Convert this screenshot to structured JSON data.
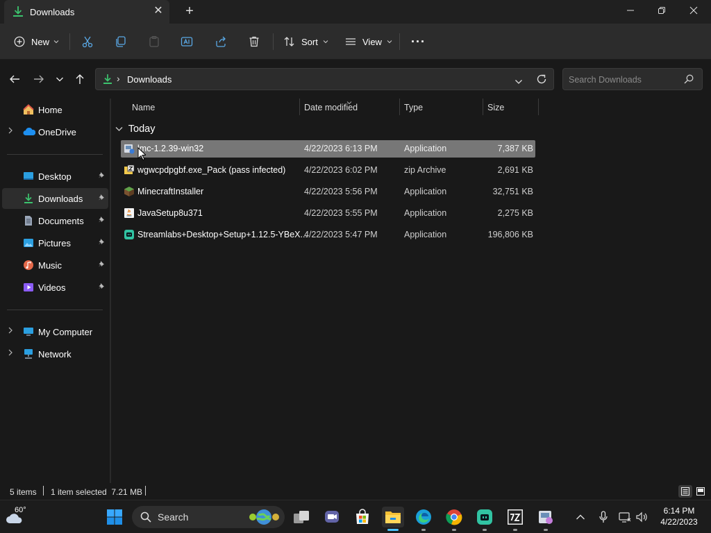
{
  "window": {
    "tab_title": "Downloads",
    "tab_close": "✕",
    "new_tab": "+"
  },
  "toolbar": {
    "new_label": "New",
    "sort_label": "Sort",
    "view_label": "View",
    "more_label": "···"
  },
  "address": {
    "path_separator": "›",
    "path": "Downloads",
    "search_placeholder": "Search Downloads"
  },
  "sidebar": {
    "items": [
      {
        "label": "Home",
        "icon": "home-icon",
        "pinned": false,
        "expandable": false
      },
      {
        "label": "OneDrive",
        "icon": "onedrive-icon",
        "pinned": false,
        "expandable": true
      },
      {
        "label": "Desktop",
        "icon": "desktop-icon",
        "pinned": true,
        "expandable": false
      },
      {
        "label": "Downloads",
        "icon": "downloads-icon",
        "pinned": true,
        "expandable": false,
        "selected": true
      },
      {
        "label": "Documents",
        "icon": "documents-icon",
        "pinned": true,
        "expandable": false
      },
      {
        "label": "Pictures",
        "icon": "pictures-icon",
        "pinned": true,
        "expandable": false
      },
      {
        "label": "Music",
        "icon": "music-icon",
        "pinned": true,
        "expandable": false
      },
      {
        "label": "Videos",
        "icon": "videos-icon",
        "pinned": true,
        "expandable": false
      },
      {
        "label": "My Computer",
        "icon": "computer-icon",
        "pinned": false,
        "expandable": true
      },
      {
        "label": "Network",
        "icon": "network-icon",
        "pinned": false,
        "expandable": true
      }
    ]
  },
  "columns": {
    "name": "Name",
    "date": "Date modified",
    "type": "Type",
    "size": "Size"
  },
  "group": {
    "label": "Today"
  },
  "files": [
    {
      "name": "lmc-1.2.39-win32",
      "date": "4/22/2023 6:13 PM",
      "type": "Application",
      "size": "7,387 KB",
      "icon": "installer-icon",
      "selected": true
    },
    {
      "name": "wgwcpdpgbf.exe_Pack (pass infected)",
      "date": "4/22/2023 6:02 PM",
      "type": "zip Archive",
      "size": "2,691 KB",
      "icon": "zip-archive-icon",
      "selected": false
    },
    {
      "name": "MinecraftInstaller",
      "date": "4/22/2023 5:56 PM",
      "type": "Application",
      "size": "32,751 KB",
      "icon": "minecraft-icon",
      "selected": false
    },
    {
      "name": "JavaSetup8u371",
      "date": "4/22/2023 5:55 PM",
      "type": "Application",
      "size": "2,275 KB",
      "icon": "java-icon",
      "selected": false
    },
    {
      "name": "Streamlabs+Desktop+Setup+1.12.5-YBeX...",
      "date": "4/22/2023 5:47 PM",
      "type": "Application",
      "size": "196,806 KB",
      "icon": "streamlabs-icon",
      "selected": false
    }
  ],
  "status": {
    "items_count": "5 items",
    "selection": "1 item selected  7.21 MB"
  },
  "taskbar": {
    "weather_temp": "60°",
    "search_label": "Search",
    "time": "6:14 PM",
    "date": "4/22/2023"
  }
}
